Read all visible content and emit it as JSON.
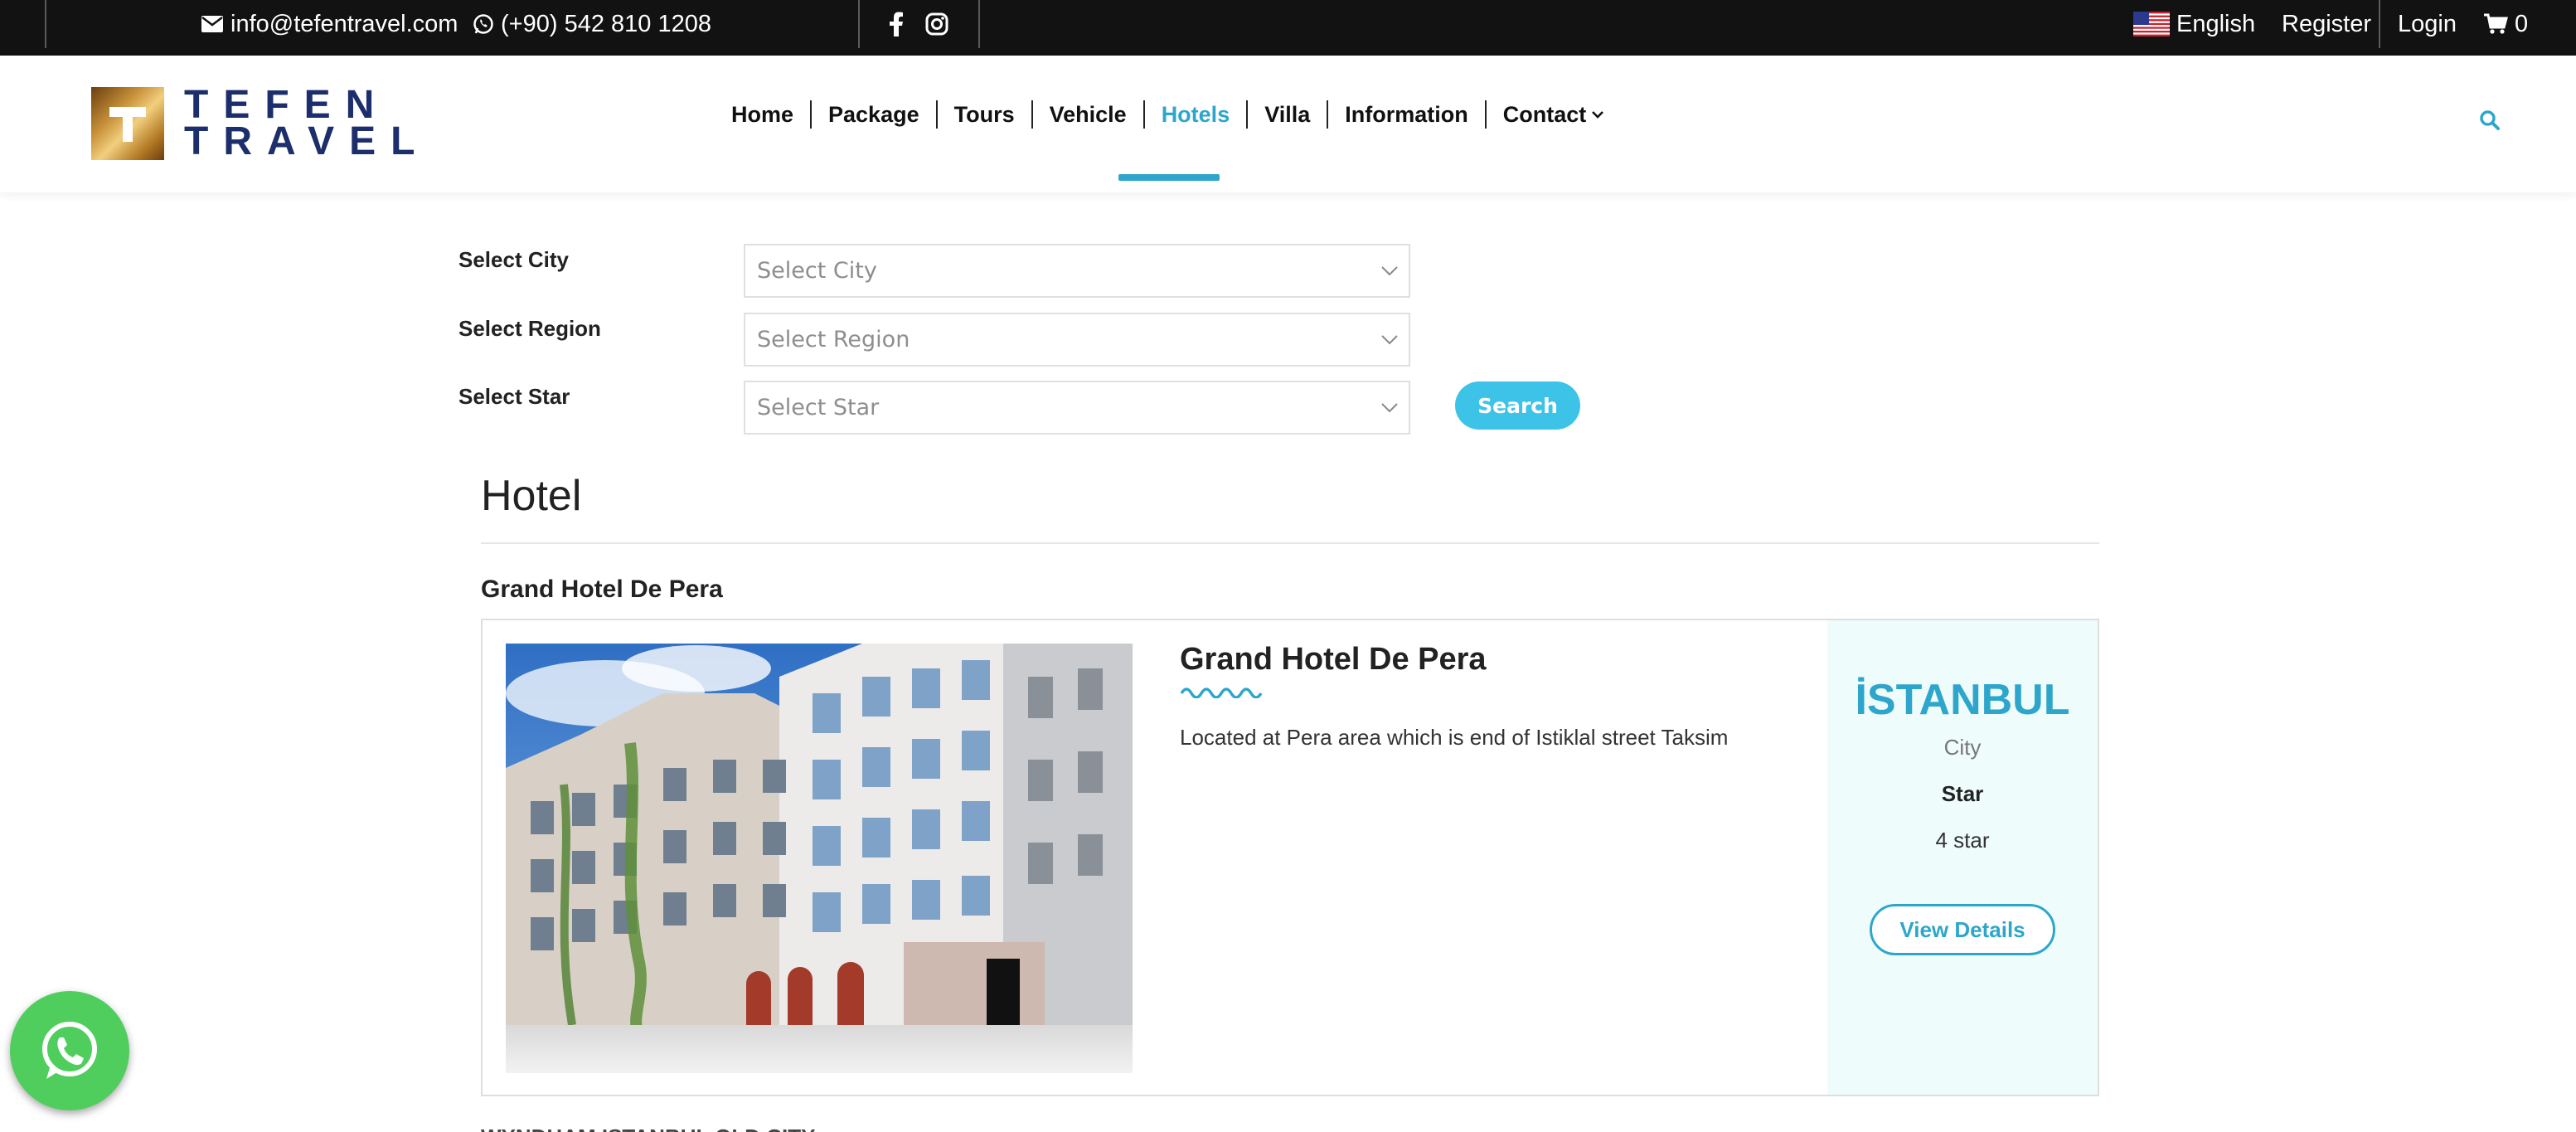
{
  "topbar": {
    "email": "info@tefentravel.com",
    "phone": "(+90) 542 810 1208",
    "social_icons": [
      "facebook-icon",
      "instagram-icon"
    ],
    "language": "English",
    "register": "Register",
    "login": "Login",
    "cart_count": "0"
  },
  "logo": {
    "line1": "TEFEN",
    "line2": "TRAVEL"
  },
  "nav": {
    "items": [
      "Home",
      "Package",
      "Tours",
      "Vehicle",
      "Hotels",
      "Villa",
      "Information",
      "Contact"
    ],
    "active": "Hotels"
  },
  "filters": {
    "city_label": "Select City",
    "city_placeholder": "Select City",
    "region_label": "Select Region",
    "region_placeholder": "Select Region",
    "star_label": "Select Star",
    "star_placeholder": "Select Star",
    "search_button": "Search"
  },
  "section": {
    "title": "Hotel",
    "hotel_heading": "Grand Hotel De Pera"
  },
  "hotel_card": {
    "name": "Grand Hotel De Pera",
    "description": "Located at Pera area which is end of Istiklal street Taksim",
    "city": "İSTANBUL",
    "city_label": "City",
    "star_label": "Star",
    "star_value": "4 star",
    "view_button": "View Details"
  },
  "next_item_peek": "WYNDHAM ISTANBUL OLD CITY",
  "colors": {
    "accent": "#2ea6cc",
    "button": "#3ec3e8",
    "topbar": "#121212",
    "logo_text": "#1c2e6b",
    "whatsapp": "#4fce5d"
  }
}
